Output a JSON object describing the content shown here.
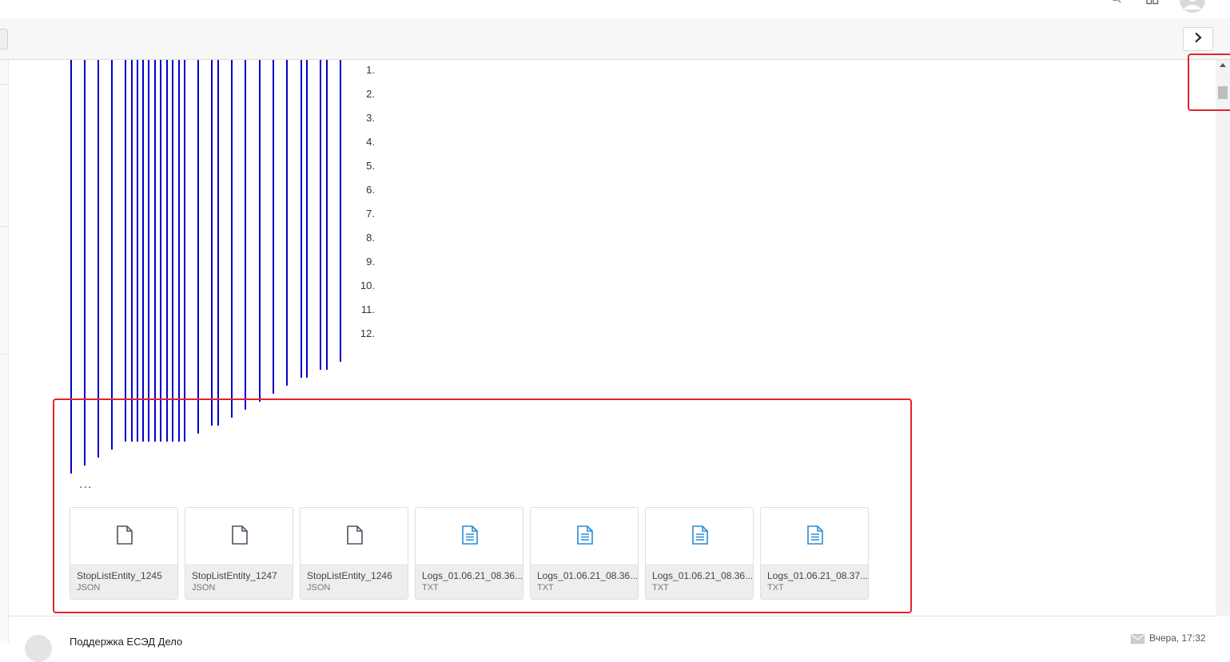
{
  "header": {
    "icons": [
      "search-icon",
      "apps-grid-icon",
      "user-avatar-icon"
    ]
  },
  "toolbar": {
    "next_icon": "chevron-right-icon"
  },
  "list_numbers": [
    "1.",
    "2.",
    "3.",
    "4.",
    "5.",
    "6.",
    "7.",
    "8.",
    "9.",
    "10.",
    "11.",
    "12."
  ],
  "ellipsis": "...",
  "attachments": [
    {
      "name": "StopListEntity_1245",
      "type": "JSON",
      "icon": "file-icon"
    },
    {
      "name": "StopListEntity_1247",
      "type": "JSON",
      "icon": "file-icon"
    },
    {
      "name": "StopListEntity_1246",
      "type": "JSON",
      "icon": "file-icon"
    },
    {
      "name": "Logs_01.06.21_08.36...",
      "type": "TXT",
      "icon": "text-file-icon"
    },
    {
      "name": "Logs_01.06.21_08.36...",
      "type": "TXT",
      "icon": "text-file-icon"
    },
    {
      "name": "Logs_01.06.21_08.36...",
      "type": "TXT",
      "icon": "text-file-icon"
    },
    {
      "name": "Logs_01.06.21_08.37...",
      "type": "TXT",
      "icon": "text-file-icon"
    }
  ],
  "next_message": {
    "sender": "Поддержка ЕСЭД Дело",
    "date": "Вчера, 17:32",
    "icon": "envelope-icon"
  },
  "colors": {
    "quote_line": "#0000cc",
    "highlight": "#e3242b",
    "text_file_icon": "#2a8bd5",
    "file_icon": "#4a5561"
  }
}
